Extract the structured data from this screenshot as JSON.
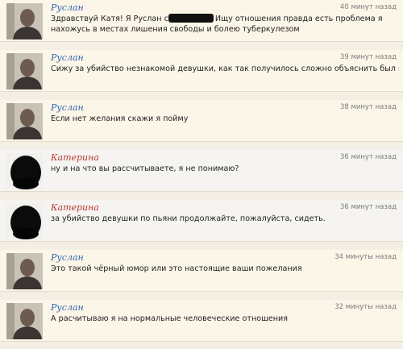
{
  "messages": [
    {
      "author": "Руслан",
      "time": "40 минут назад",
      "line1_a": "Здравствуй Катя! Я Руслан с",
      "line1_b": "Ищу отношения правда есть проблема я",
      "line2": "нахожусь в местах лишения свободы и болею туберкулезом"
    },
    {
      "author": "Руслан",
      "time": "39 минут назад",
      "text": "Сижу за убийство незнакомой девушки, как так получилось сложно объяснить был пьян"
    },
    {
      "author": "Руслан",
      "time": "38 минут назад",
      "text": "Если нет желания скажи я пойму"
    },
    {
      "author": "Катерина",
      "time": "36 минут назад",
      "text": "ну и на что вы рассчитываете, я не понимаю?"
    },
    {
      "author": "Катерина",
      "time": "36 минут назад",
      "text": "за убийство девушки по пьяни продолжайте, пожалуйста, сидеть."
    },
    {
      "author": "Руслан",
      "time": "34 минуты назад",
      "text": "Это такой чёрный юмор или это настоящие ваши пожелания"
    },
    {
      "author": "Руслан",
      "time": "32 минуты назад",
      "text": "А расчитываю я на нормальные человеческие отношения"
    }
  ]
}
